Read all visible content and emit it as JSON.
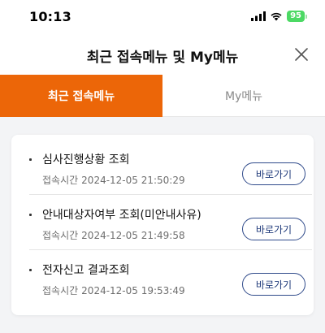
{
  "status_bar": {
    "time": "10:13",
    "battery": "95",
    "signal_icon": "cellular-signal-icon",
    "wifi_icon": "wifi-icon"
  },
  "header": {
    "title": "최근 접속메뉴 및 My메뉴",
    "close_icon": "close-icon"
  },
  "tabs": [
    {
      "label": "최근 접속메뉴",
      "active": true
    },
    {
      "label": "My메뉴",
      "active": false
    }
  ],
  "recent_items": [
    {
      "title": "심사진행상황 조회",
      "time_label": "접속시간",
      "timestamp": "2024-12-05 21:50:29",
      "button_label": "바로가기"
    },
    {
      "title": "안내대상자여부 조회(미안내사유)",
      "time_label": "접속시간",
      "timestamp": "2024-12-05 21:49:58",
      "button_label": "바로가기"
    },
    {
      "title": "전자신고 결과조회",
      "time_label": "접속시간",
      "timestamp": "2024-12-05 19:53:49",
      "button_label": "바로가기"
    }
  ],
  "colors": {
    "accent": "#ec6608",
    "button_border": "#2f4a8a",
    "background": "#f3f4f6"
  }
}
